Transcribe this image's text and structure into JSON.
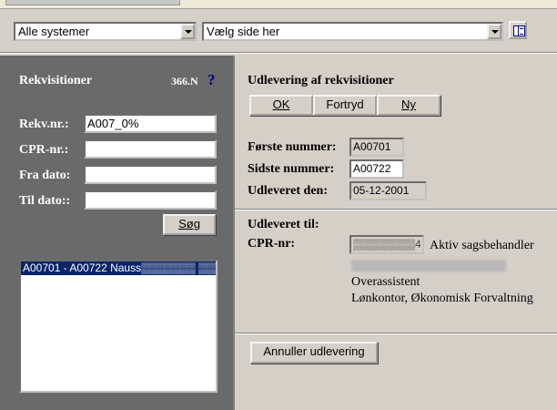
{
  "top_bar": {
    "system_select": "Alle systemer",
    "page_select": "Vælg side her"
  },
  "left": {
    "title": "Rekvisitioner",
    "code": "366.N",
    "help": "?",
    "fields": [
      {
        "label": "Rekv.nr.:",
        "value": "A007_0%"
      },
      {
        "label": "CPR-nr.:",
        "value": ""
      },
      {
        "label": "Fra dato:",
        "value": ""
      },
      {
        "label": "Til dato::",
        "value": ""
      }
    ],
    "search_button": "Søg",
    "results": [
      "A00701 - A00722 Nauss▒▒▒▒▒▒▒ ▒▒▒ Hans"
    ]
  },
  "right": {
    "heading": "Udlevering af rekvisitioner",
    "buttons": {
      "ok": "OK",
      "cancel": "Fortryd",
      "new": "Ny"
    },
    "first_label": "Første nummer:",
    "first_value": "A00701",
    "last_label": "Sidste nummer:",
    "last_value": "A00722",
    "date_label": "Udleveret den:",
    "date_value": "05-12-2001",
    "to_heading": "Udleveret til:",
    "cpr_label": "CPR-nr:",
    "cpr_value": "▒▒▒▒▒▒▒▒4",
    "status": "Aktiv sagsbehandler",
    "title_line": "Overassistent",
    "department": "Lønkontor, Økonomisk Forvaltning",
    "annul_button": "Annuller udlevering"
  }
}
